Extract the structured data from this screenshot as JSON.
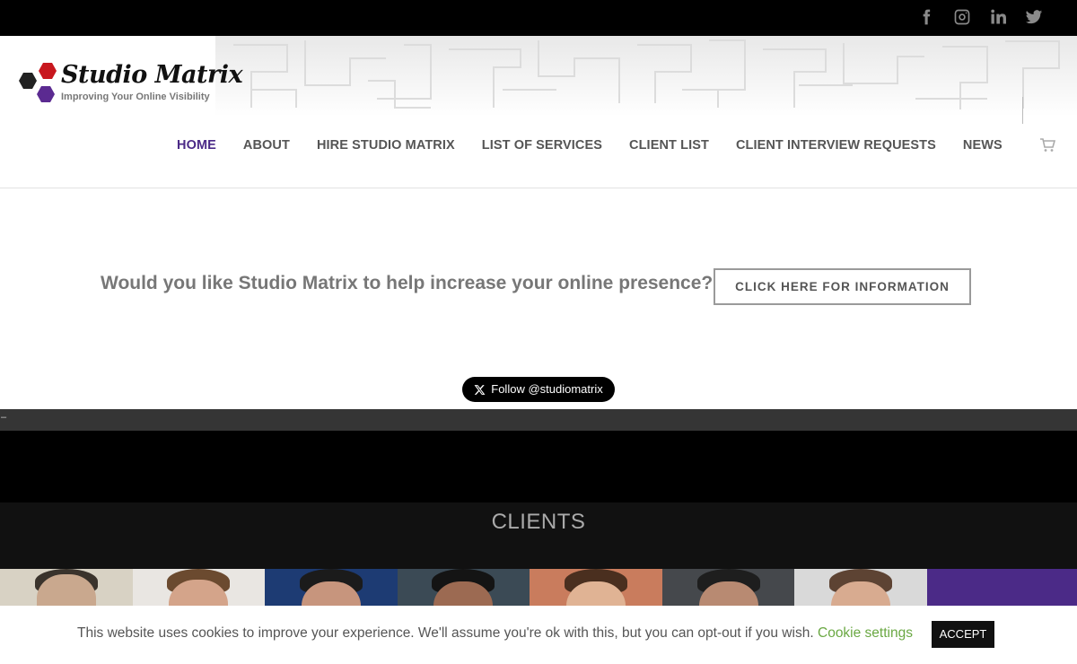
{
  "topbar": {
    "social": [
      {
        "name": "facebook-icon"
      },
      {
        "name": "instagram-icon"
      },
      {
        "name": "linkedin-icon"
      },
      {
        "name": "twitter-icon"
      }
    ],
    "icon_color": "#8a8a8a"
  },
  "logo": {
    "title": "Studio Matrix",
    "tagline": "Improving Your Online Visibility",
    "hex_colors": [
      "#c8171e",
      "#222222",
      "#5b2a91"
    ]
  },
  "nav": {
    "items": [
      {
        "label": "HOME",
        "active": true
      },
      {
        "label": "ABOUT"
      },
      {
        "label": "HIRE STUDIO MATRIX"
      },
      {
        "label": "LIST OF SERVICES"
      },
      {
        "label": "CLIENT LIST"
      },
      {
        "label": "CLIENT INTERVIEW REQUESTS"
      },
      {
        "label": "NEWS"
      }
    ],
    "active_color": "#4b2a87",
    "cart_icon": "cart-icon"
  },
  "promo": {
    "question": "Would you like Studio Matrix to help increase your online presence?",
    "button_label": "CLICK HERE FOR INFORMATION"
  },
  "twitter_follow": {
    "label": "Follow @studiomatrix"
  },
  "strip": {
    "dash": "–"
  },
  "clients": {
    "title": "CLIENTS"
  },
  "cookie": {
    "message": "This website uses cookies to improve your experience. We'll assume you're ok with this, but you can opt-out if you wish.",
    "settings_label": "Cookie settings",
    "accept_label": "ACCEPT",
    "settings_color": "#6aa843"
  }
}
